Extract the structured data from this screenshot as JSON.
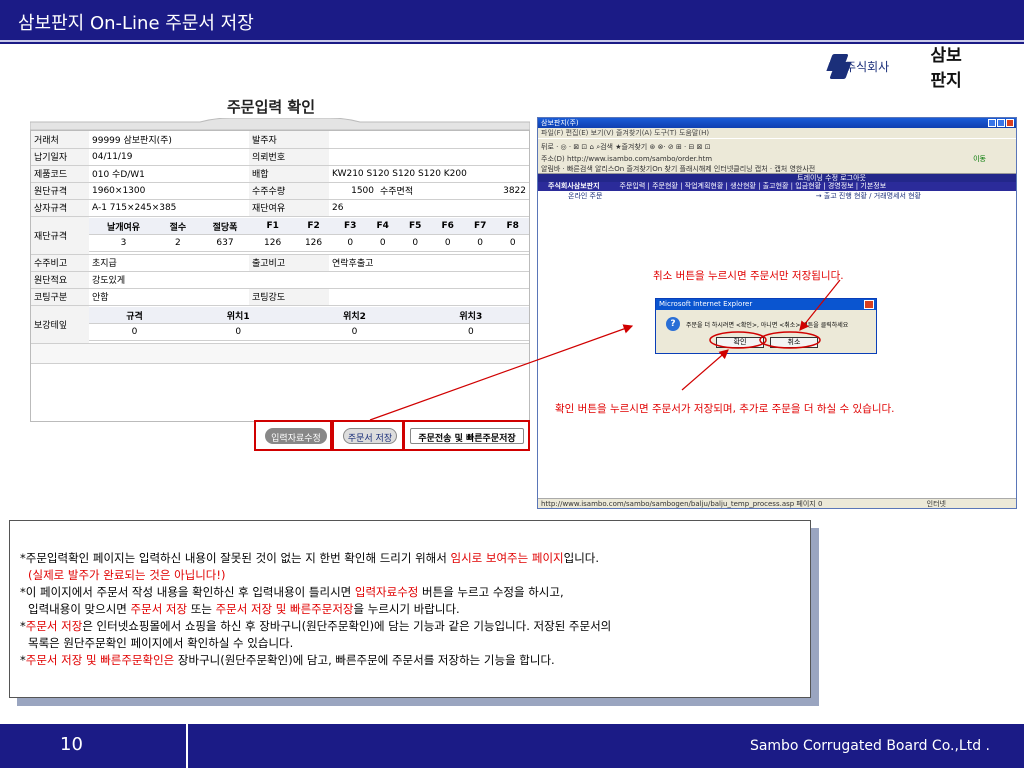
{
  "header": {
    "title": "삼보판지 On-Line 주문서 저장"
  },
  "logo": {
    "prefix": "주식회사",
    "name": "삼보판지"
  },
  "form": {
    "heading": "주문입력 확인",
    "rows": {
      "customer_label": "거래처",
      "customer_value": "99999 삼보판지(주)",
      "orderer_label": "발주자",
      "orderer_value": "",
      "delivery_label": "납기일자",
      "delivery_value": "04/11/19",
      "request_label": "의뢰번호",
      "request_value": "",
      "product_label": "제품코드",
      "product_value": "010 수D/W1",
      "mix_label": "배합",
      "mix_value": "KW210 S120 S120 S120 K200",
      "size_label": "원단규격",
      "size_value": "1960×1300",
      "qty_label": "수주수량",
      "qty_value": "1500",
      "area_label": "수주면적",
      "area_value": "3822",
      "box_label": "상자규격",
      "box_value": "A-1 715×245×385",
      "margin_label": "재단여유",
      "margin_value": "26",
      "cut_label": "재단규격",
      "cut_headers": [
        "날개여유",
        "절수",
        "절당폭",
        "F1",
        "F2",
        "F3",
        "F4",
        "F5",
        "F6",
        "F7",
        "F8"
      ],
      "cut_values": [
        "3",
        "2",
        "637",
        "126",
        "126",
        "0",
        "0",
        "0",
        "0",
        "0",
        "0"
      ],
      "note_label": "수주비고",
      "note_value": "초지급",
      "ship_label": "출고비고",
      "ship_value": "연락후출고",
      "sheet_label": "원단적요",
      "sheet_value": "강도있게",
      "coating_label": "코팅구분",
      "coating_value": "안함",
      "strength_label": "코팅강도",
      "strength_value": "",
      "reinforce_label": "보강테잎",
      "reinforce_headers": [
        "규격",
        "위치1",
        "위치2",
        "위치3"
      ],
      "reinforce_values": [
        "0",
        "0",
        "0",
        "0"
      ]
    },
    "buttons": {
      "edit": "입력자료수정",
      "save": "주문서 저장",
      "send": "주문전송 및 빠른주문저장"
    }
  },
  "browser": {
    "title": "삼보판지(주)",
    "menu": "파일(F)  편집(E)  보기(V)  즐겨찾기(A)  도구(T)  도움말(H)",
    "toolbar": "뒤로 · ◎ · ⊠ ⊡ ⌂  ⌕검색  ★즐겨찾기  ⊛  ⊗· ⊘  ⊞ · ⊟ ⊠ ⊡",
    "address": "주소(D)  http://www.isambo.com/sambo/order.htm",
    "go": "이동",
    "links": "알림바 · 빠른검색  알리스On  즐겨찾기On  찾기  플래시해제  인터넷클리닝  캡처 · 캡처  영한사전",
    "site_top": "트레이닝 수정  로그아웃",
    "site_company": "주식회사삼보판지",
    "site_nav": "주문입력 | 주문현황 | 작업계획현황 | 생산현황 | 출고현황 | 입금현황 | 경영정보 | 기본정보",
    "site_crumb_left": "온라인 주문",
    "site_crumb_right": "→ 출고 진행 현황 / 거래명세서 현황",
    "status": "http://www.isambo.com/sambo/sambogen/balju/balju_temp_process.asp 페이지 0",
    "zone": "인터넷"
  },
  "dialog": {
    "title": "Microsoft Internet Explorer",
    "message": "주문을 더 하시려면 <확인>, 아니면 <취소> 버튼을 클릭하세요",
    "ok": "확인",
    "cancel": "취소"
  },
  "annotations": {
    "cancel_note": "취소 버튼을 누르시면 주문서만 저장됩니다.",
    "ok_note": "확인 버튼을 누르시면 주문서가 저장되며, 추가로 주문을 더 하실 수 있습니다."
  },
  "explain": {
    "l1a": "*주문입력확인 페이지는 입력하신 내용이 잘못된 것이 없는 지  한번 확인해 드리기 위해서 ",
    "l1b": "임시로 보여주는 페이지",
    "l1c": "입니다.",
    "l2": "(실제로 발주가 완료되는 것은 아닙니다!)",
    "l3a": "*이 페이지에서 주문서 작성 내용을 확인하신 후 입력내용이 틀리시면 ",
    "l3b": "입력자료수정",
    "l3c": " 버튼을 누르고 수정을 하시고,",
    "l4a": "입력내용이 맞으시면 ",
    "l4b": "주문서 저장",
    "l4c": " 또는  ",
    "l4d": "주문서 저장 및 빠른주문저장",
    "l4e": "을 누르시기 바랍니다.",
    "l5a": "*",
    "l5b": "주문서 저장",
    "l5c": "은 인터넷쇼핑몰에서 쇼핑을 하신 후 장바구니(원단주문확인)에 담는 기능과  같은 기능입니다.  저장된 주문서의",
    "l6": "목록은  원단주문확인  페이지에서 확인하실 수 있습니다.",
    "l7a": "*",
    "l7b": "주문서 저장 및 빠른주문확인은",
    "l7c": " 장바구니(원단주문확인)에 담고, 빠른주문에 주문서를 저장하는 기능을 합니다."
  },
  "footer": {
    "page": "10",
    "company": "Sambo Corrugated Board Co.,Ltd ."
  },
  "colors": {
    "band": "#1b1b86",
    "highlight": "#e00000",
    "arrow": "#d00000"
  }
}
